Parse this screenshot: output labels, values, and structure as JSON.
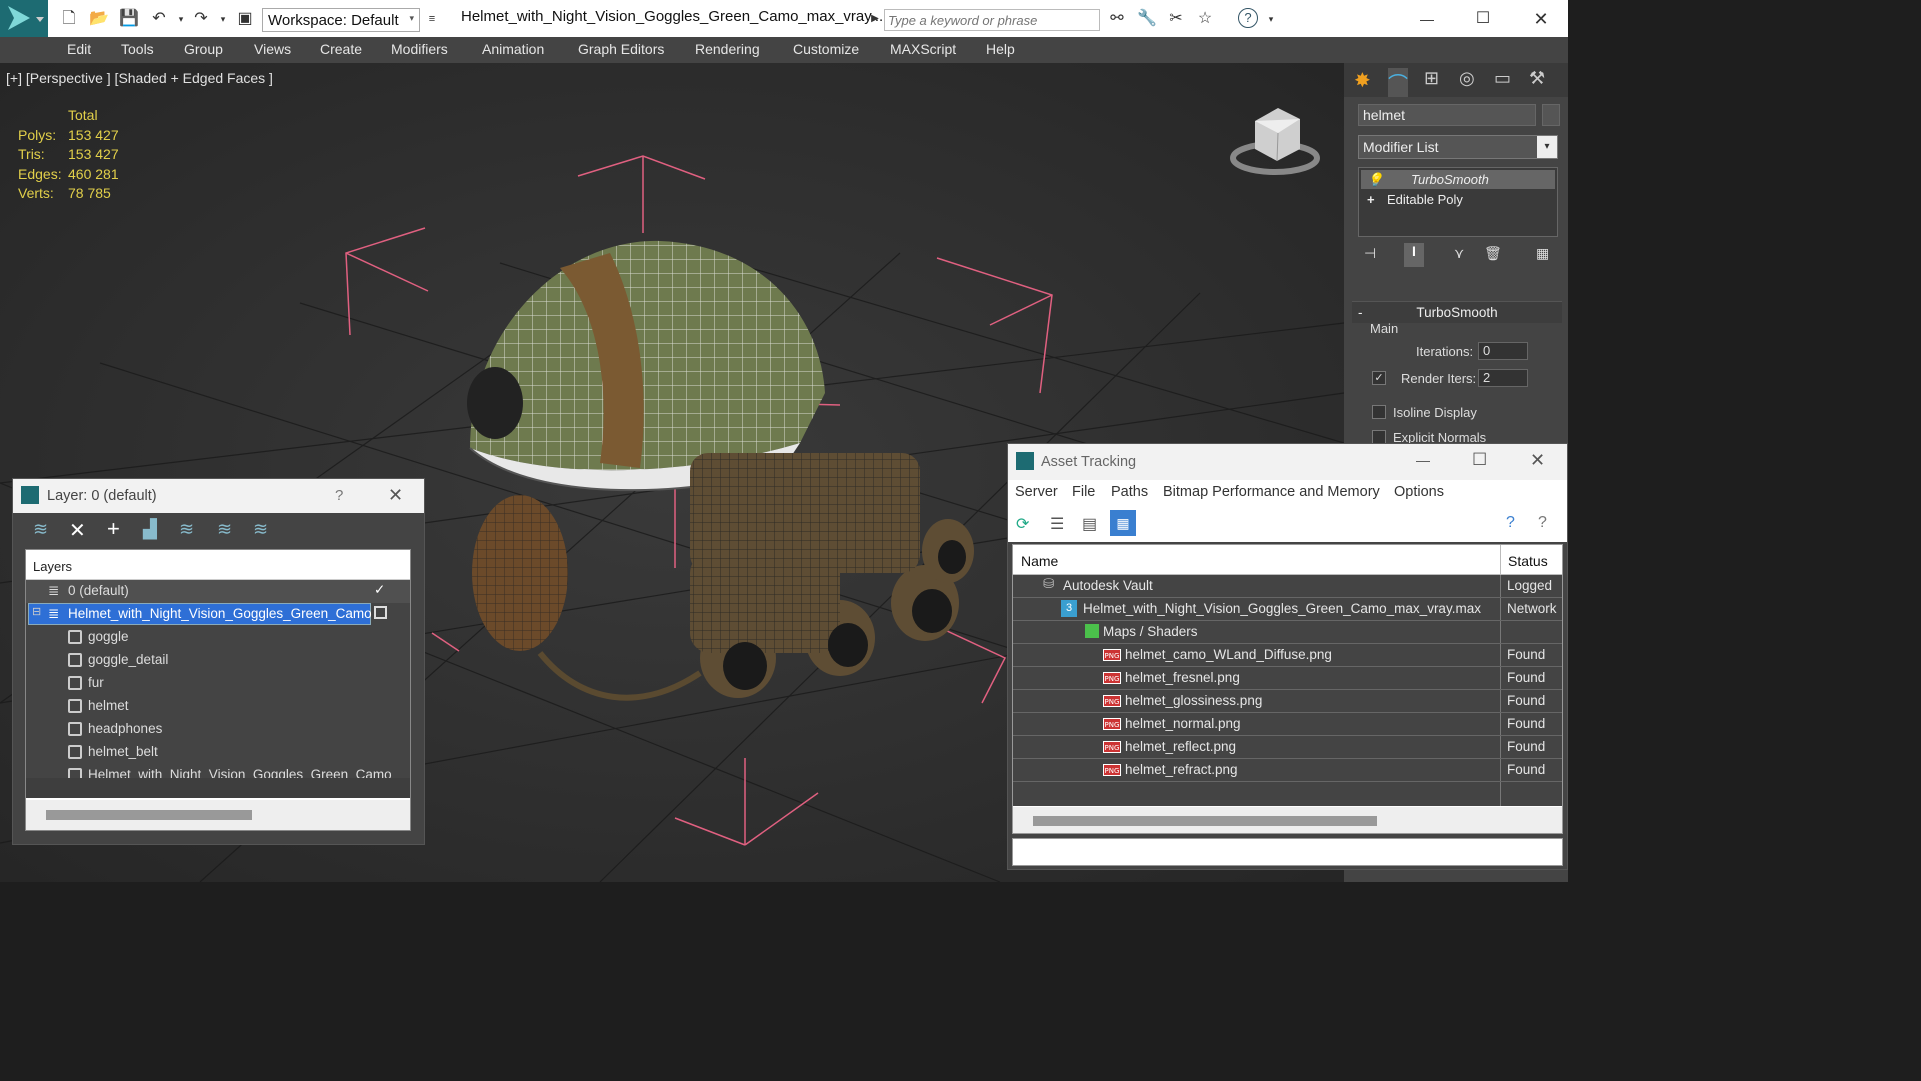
{
  "titlebar": {
    "workspace": "Workspace: Default",
    "filename": "Helmet_with_Night_Vision_Goggles_Green_Camo_max_vray....",
    "search_placeholder": "Type a keyword or phrase"
  },
  "menu": [
    "Edit",
    "Tools",
    "Group",
    "Views",
    "Create",
    "Modifiers",
    "Animation",
    "Graph Editors",
    "Rendering",
    "Customize",
    "MAXScript",
    "Help"
  ],
  "viewport": {
    "label": "[+] [Perspective ] [Shaded + Edged Faces ]",
    "stats_header": "Total",
    "stats": [
      {
        "label": "Polys:",
        "value": "153 427"
      },
      {
        "label": "Tris:",
        "value": "153 427"
      },
      {
        "label": "Edges:",
        "value": "460 281"
      },
      {
        "label": "Verts:",
        "value": "78 785"
      }
    ]
  },
  "command_panel": {
    "object_name": "helmet",
    "modifier_list": "Modifier List",
    "stack": [
      "TurboSmooth",
      "Editable Poly"
    ],
    "rollout_title": "TurboSmooth",
    "group_main": "Main",
    "iterations_label": "Iterations:",
    "iterations_value": "0",
    "render_iters_label": "Render Iters:",
    "render_iters_value": "2",
    "isoline_label": "Isoline Display",
    "explicit_label": "Explicit Normals"
  },
  "layer_window": {
    "title": "Layer: 0 (default)",
    "help": "?",
    "column": "Layers",
    "layers": [
      {
        "name": "0 (default)"
      },
      {
        "name": "Helmet_with_Night_Vision_Goggles_Green_Camo"
      }
    ],
    "objects": [
      "goggle",
      "goggle_detail",
      "fur",
      "helmet",
      "headphones",
      "helmet_belt",
      "Helmet_with_Night_Vision_Goggles_Green_Camo"
    ]
  },
  "asset_window": {
    "title": "Asset Tracking",
    "menu": [
      "Server",
      "File",
      "Paths",
      "Bitmap Performance and Memory",
      "Options"
    ],
    "col_name": "Name",
    "col_status": "Status",
    "vault": {
      "name": "Autodesk Vault",
      "status": "Logged"
    },
    "maxfile": {
      "name": "Helmet_with_Night_Vision_Goggles_Green_Camo_max_vray.max",
      "status": "Network"
    },
    "group": "Maps / Shaders",
    "maps": [
      {
        "name": "helmet_camo_WLand_Diffuse.png",
        "status": "Found"
      },
      {
        "name": "helmet_fresnel.png",
        "status": "Found"
      },
      {
        "name": "helmet_glossiness.png",
        "status": "Found"
      },
      {
        "name": "helmet_normal.png",
        "status": "Found"
      },
      {
        "name": "helmet_reflect.png",
        "status": "Found"
      },
      {
        "name": "helmet_refract.png",
        "status": "Found"
      }
    ]
  }
}
